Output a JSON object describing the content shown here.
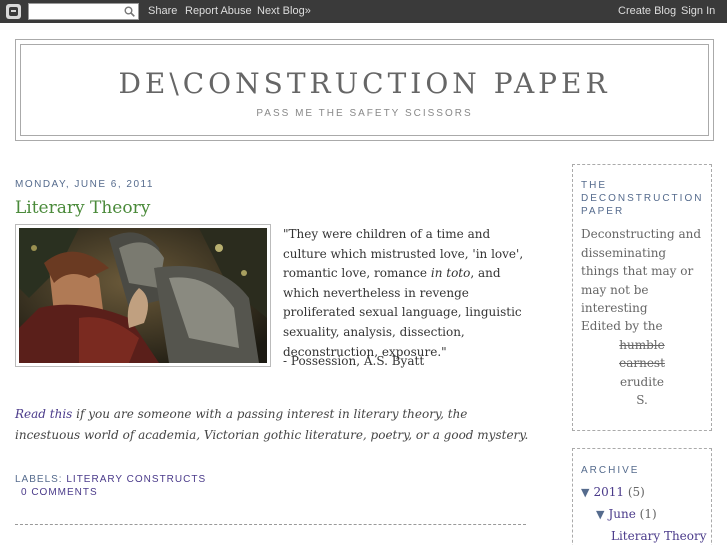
{
  "navbar": {
    "search_placeholder": "",
    "share": "Share",
    "report_abuse": "Report Abuse",
    "next_blog": "Next Blog»",
    "create_blog": "Create Blog",
    "sign_in": "Sign In"
  },
  "header": {
    "title": "DE\\CONSTRUCTION PAPER",
    "description": "PASS ME THE SAFETY SCISSORS"
  },
  "post": {
    "date": "MONDAY, JUNE 6, 2011",
    "title": "Literary Theory",
    "quote_part1": "\"They were children of a time and culture which mistrusted love, 'in love', romantic love, romance ",
    "quote_italic": "in toto",
    "quote_part2": ", and which nevertheless in revenge proliferated sexual language, linguistic sexuality, analysis, dissection, deconstruction, exposure.\"",
    "attribution": "- Possession, A.S. Byatt",
    "read_link": "Read this",
    "read_rest": " if you are someone with a passing interest in literary theory, the incestuous world of academia, Victorian gothic literature, poetry, or a good mystery.",
    "labels_prefix": "LABELS: ",
    "label": "LITERARY CONSTRUCTS",
    "comments": "0 COMMENTS"
  },
  "sidebar": {
    "about_heading": "THE DECONSTRUCTION PAPER",
    "about_desc": "Deconstructing and disseminating things that may or may not be interesting",
    "edited_by": "Edited by the",
    "editor_words": [
      "humble",
      "earnest",
      "erudite",
      "S."
    ],
    "archive_heading": "ARCHIVE",
    "archive": {
      "year": "2011",
      "year_count": "(5)",
      "month": "June",
      "month_count": "(1)",
      "post": "Literary Theory"
    }
  },
  "colors": {
    "navbar": "#3a3a3a",
    "title_green": "#4a8a3a",
    "link_purple": "#4a3a8a",
    "heading_blue": "#556b8d"
  }
}
